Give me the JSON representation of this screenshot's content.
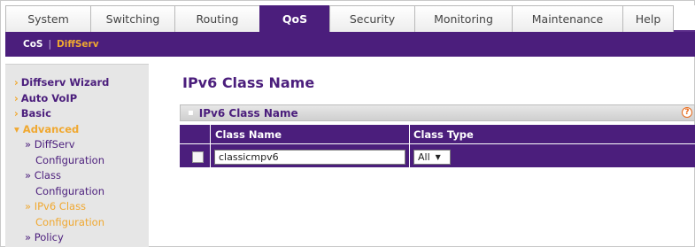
{
  "tabs": [
    {
      "label": "System"
    },
    {
      "label": "Switching"
    },
    {
      "label": "Routing"
    },
    {
      "label": "QoS"
    },
    {
      "label": "Security"
    },
    {
      "label": "Monitoring"
    },
    {
      "label": "Maintenance"
    },
    {
      "label": "Help"
    }
  ],
  "active_tab": "QoS",
  "subnav": {
    "cos": "CoS",
    "separator": "|",
    "diffserv": "DiffServ"
  },
  "leftnav": {
    "arrow": "›",
    "adv_arrow": "▾",
    "items": {
      "wizard": "Diffserv Wizard",
      "autovoip": "Auto VoIP",
      "basic": "Basic",
      "advanced": "Advanced",
      "diffserv_1": "» DiffServ",
      "diffserv_2": "Configuration",
      "class_1": "» Class",
      "class_2": "Configuration",
      "ipv6_1": "» IPv6 Class",
      "ipv6_2": "Configuration",
      "policy": "» Policy"
    }
  },
  "page_title": "IPv6 Class Name",
  "panel": {
    "title": "IPv6 Class Name",
    "help": "?"
  },
  "table": {
    "headers": {
      "name": "Class Name",
      "type": "Class Type"
    },
    "row": {
      "name_value": "classicmpv6",
      "type_value": "All"
    }
  },
  "colors": {
    "accent": "#4b1e7c",
    "highlight": "#f0a830"
  }
}
